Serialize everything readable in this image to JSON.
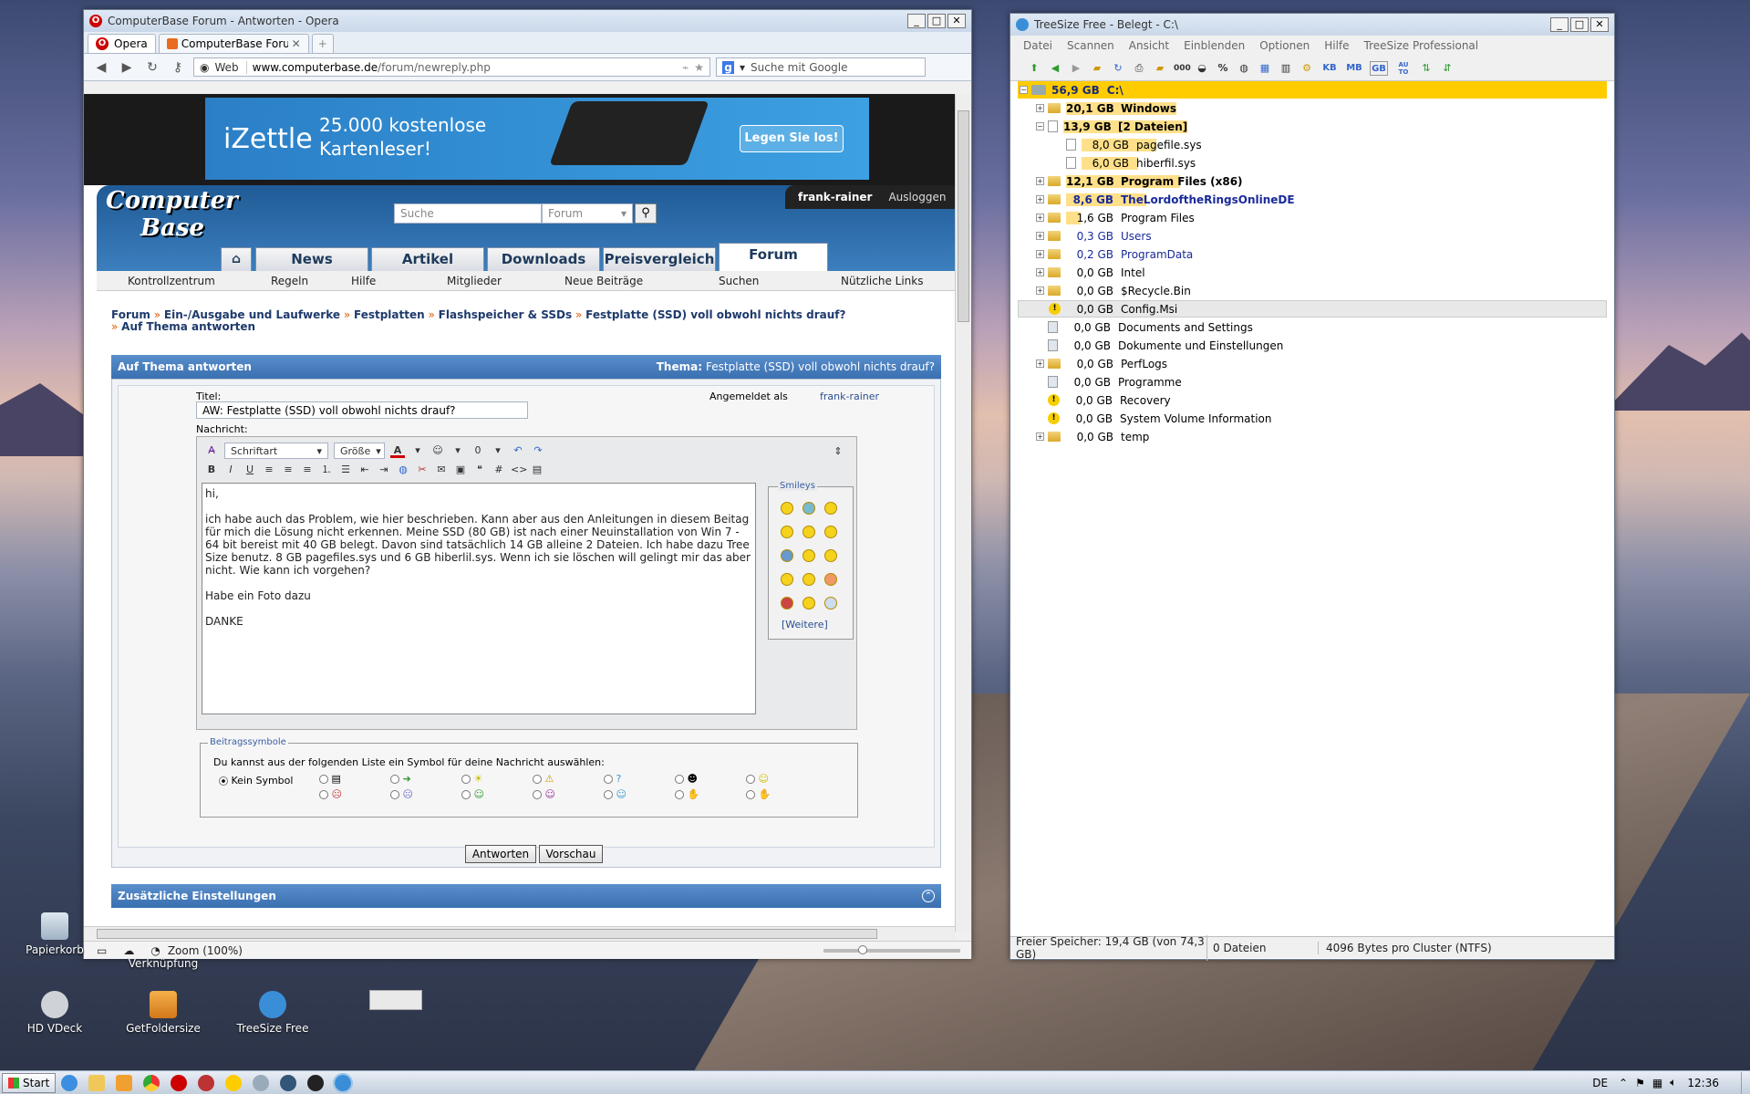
{
  "opera": {
    "title": "ComputerBase Forum - Antworten - Opera",
    "menu_label": "Opera",
    "tab_label": "ComputerBase Forum ...",
    "web_label": "Web",
    "url_host": "www.computerbase.de",
    "url_path": "/forum/newreply.php",
    "search_placeholder": "Suche mit Google",
    "zoom_label": "Zoom (100%)"
  },
  "ad": {
    "brand": "iZettle",
    "tagline_1": "25.000 kostenlose",
    "tagline_2": "Kartenleser!",
    "cta": "Legen Sie los!"
  },
  "site": {
    "logo_1": "Computer",
    "logo_2": "Base",
    "search_placeholder": "Suche",
    "search_scope": "Forum",
    "user": "frank-rainer",
    "logout": "Ausloggen",
    "tabs": [
      "News",
      "Artikel",
      "Downloads",
      "Preisvergleich",
      "Forum"
    ],
    "subnav": [
      "Kontrollzentrum",
      "Regeln",
      "Hilfe",
      "Mitglieder",
      "Neue Beiträge",
      "Suchen",
      "Nützliche Links"
    ]
  },
  "breadcrumb": {
    "items": [
      "Forum",
      "Ein-/Ausgabe und Laufwerke",
      "Festplatten",
      "Flashspeicher & SSDs",
      "Festplatte (SSD) voll obwohl nichts drauf?"
    ],
    "current": "Auf Thema antworten"
  },
  "reply": {
    "header": "Auf Thema antworten",
    "thema_label": "Thema:",
    "thema_value": "Festplatte (SSD) voll obwohl nichts drauf?",
    "title_label": "Titel:",
    "title_value": "AW: Festplatte (SSD) voll obwohl nichts drauf?",
    "logged_in_label": "Angemeldet als",
    "logged_in_user": "frank-rainer",
    "message_label": "Nachricht:",
    "font_select": "Schriftart",
    "size_select": "Größe",
    "message_text": "hi,\n\nich habe auch das Problem, wie hier beschrieben. Kann aber aus den Anleitungen in diesem Beitag für mich die Lösung nicht erkennen. Meine SSD (80 GB) ist nach einer Neuinstallation von Win 7 - 64 bit bereist mit 40 GB belegt. Davon sind tatsächlich 14 GB alleine 2 Dateien. Ich habe dazu Tree Size benutz. 8 GB pagefiles.sys und 6 GB hiberlil.sys. Wenn ich sie löschen will gelingt mir das aber nicht. Wie kann ich vorgehen?\n\nHabe ein Foto dazu\n\nDANKE",
    "smileys_label": "Smileys",
    "smileys_more": "[Weitere]",
    "symbols_legend": "Beitragssymbole",
    "symbols_hint": "Du kannst aus der folgenden Liste ein Symbol für deine Nachricht auswählen:",
    "no_symbol": "Kein Symbol",
    "submit": "Antworten",
    "preview": "Vorschau",
    "extra_settings": "Zusätzliche Einstellungen"
  },
  "treesize": {
    "title": "TreeSize Free - Belegt - C:\\",
    "menu": [
      "Datei",
      "Scannen",
      "Ansicht",
      "Einblenden",
      "Optionen",
      "Hilfe",
      "TreeSize Professional"
    ],
    "unit_buttons": [
      "KB",
      "MB",
      "GB",
      "AU TO"
    ],
    "root_size": "56,9 GB",
    "root_name": "C:\\",
    "rows": [
      {
        "size": "20,1 GB",
        "name": "Windows",
        "kind": "folder",
        "level": 1,
        "bold": true
      },
      {
        "size": "13,9 GB",
        "name": "[2 Dateien]",
        "kind": "file",
        "level": 1,
        "bold": true
      },
      {
        "size": "8,0 GB",
        "name": "pagefile.sys",
        "kind": "file",
        "level": 2,
        "bold": false
      },
      {
        "size": "6,0 GB",
        "name": "hiberfil.sys",
        "kind": "file",
        "level": 2,
        "bold": false
      },
      {
        "size": "12,1 GB",
        "name": "Program Files (x86)",
        "kind": "folder",
        "level": 1,
        "bold": true
      },
      {
        "size": "8,6 GB",
        "name": "TheLordoftheRingsOnlineDE",
        "kind": "folder",
        "level": 1,
        "bold": true
      },
      {
        "size": "1,6 GB",
        "name": "Program Files",
        "kind": "folder",
        "level": 1,
        "bold": false
      },
      {
        "size": "0,3 GB",
        "name": "Users",
        "kind": "folder",
        "level": 1,
        "bold": false
      },
      {
        "size": "0,2 GB",
        "name": "ProgramData",
        "kind": "folder",
        "level": 1,
        "bold": false
      },
      {
        "size": "0,0 GB",
        "name": "Intel",
        "kind": "folder",
        "level": 1,
        "bold": false
      },
      {
        "size": "0,0 GB",
        "name": "$Recycle.Bin",
        "kind": "folder",
        "level": 1,
        "bold": false
      },
      {
        "size": "0,0 GB",
        "name": "Config.Msi",
        "kind": "warn",
        "level": 1,
        "bold": false
      },
      {
        "size": "0,0 GB",
        "name": "Documents and Settings",
        "kind": "link",
        "level": 1,
        "bold": false
      },
      {
        "size": "0,0 GB",
        "name": "Dokumente und Einstellungen",
        "kind": "link",
        "level": 1,
        "bold": false
      },
      {
        "size": "0,0 GB",
        "name": "PerfLogs",
        "kind": "folder",
        "level": 1,
        "bold": false
      },
      {
        "size": "0,0 GB",
        "name": "Programme",
        "kind": "link",
        "level": 1,
        "bold": false
      },
      {
        "size": "0,0 GB",
        "name": "Recovery",
        "kind": "warn",
        "level": 1,
        "bold": false
      },
      {
        "size": "0,0 GB",
        "name": "System Volume Information",
        "kind": "warn",
        "level": 1,
        "bold": false
      },
      {
        "size": "0,0 GB",
        "name": "temp",
        "kind": "folder",
        "level": 1,
        "bold": false
      }
    ],
    "status_free": "Freier Speicher: 19,4 GB  (von 74,3 GB)",
    "status_files": "0  Dateien",
    "status_cluster": "4096 Bytes pro Cluster (NTFS)"
  },
  "desktop": {
    "icons": [
      "Papierkorb",
      "Verknüpfung",
      "HD VDeck",
      "GetFoldersize",
      "TreeSize Free"
    ]
  },
  "taskbar": {
    "start": "Start",
    "lang": "DE",
    "time": "12:36"
  },
  "colors": {
    "accent": "#3a6fb0",
    "highlight": "#ffe08a",
    "selected_root": "#ffcc00"
  }
}
